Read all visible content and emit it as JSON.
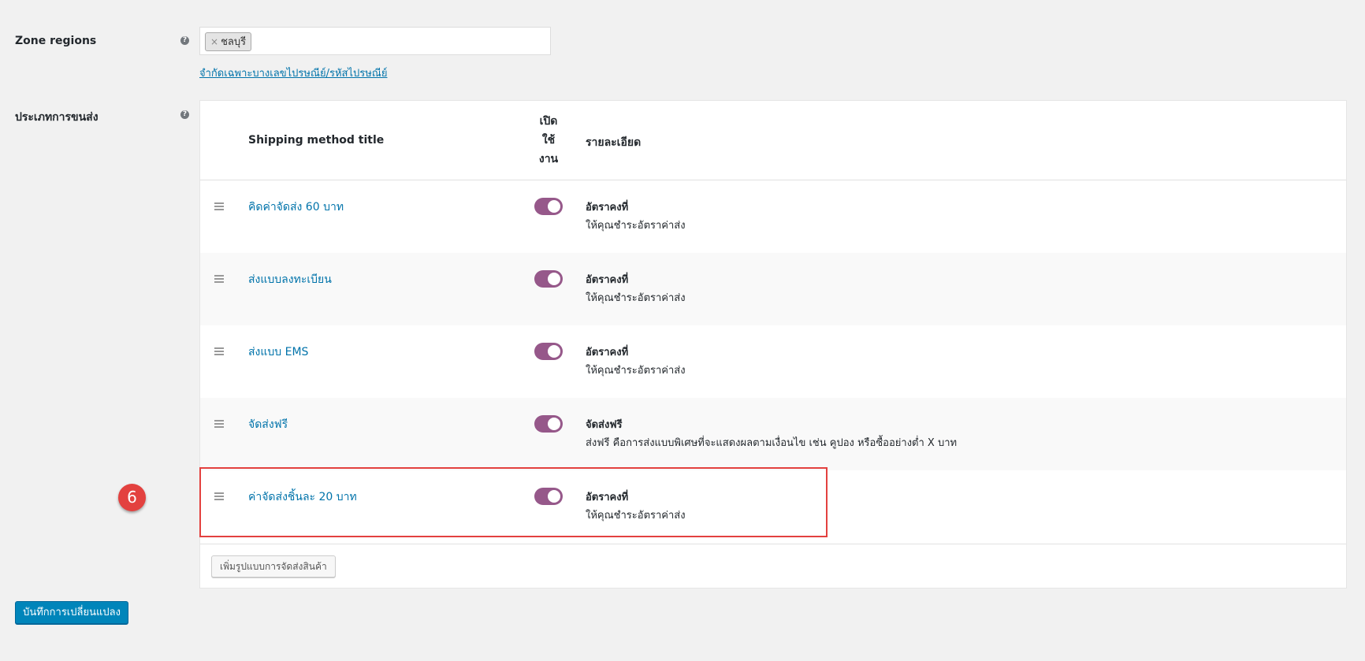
{
  "zone_regions": {
    "label": "Zone regions",
    "help_icon": "?",
    "chips": [
      {
        "remove": "×",
        "label": "ชลบุรี"
      }
    ],
    "postcode_link": "จำกัดเฉพาะบางเลขไปรษณีย์/รหัสไปรษณีย์"
  },
  "shipping_methods": {
    "label": "ประเภทการขนส่ง",
    "help_icon": "?",
    "headers": {
      "title": "Shipping method title",
      "enabled_line1": "เปิด",
      "enabled_line2": "ใช้",
      "enabled_line3": "งาน",
      "description": "รายละเอียด"
    },
    "rows": [
      {
        "title": "คิดค่าจัดส่ง 60 บาท",
        "enabled": true,
        "desc_title": "อัตราคงที่",
        "desc_text": "ให้คุณชำระอัตราค่าส่ง"
      },
      {
        "title": "ส่งแบบลงทะเบียน",
        "enabled": true,
        "desc_title": "อัตราคงที่",
        "desc_text": "ให้คุณชำระอัตราค่าส่ง"
      },
      {
        "title": "ส่งแบบ EMS",
        "enabled": true,
        "desc_title": "อัตราคงที่",
        "desc_text": "ให้คุณชำระอัตราค่าส่ง"
      },
      {
        "title": "จัดส่งฟรี",
        "enabled": true,
        "desc_title": "จัดส่งฟรี",
        "desc_text": "ส่งฟรี คือการส่งแบบพิเศษที่จะแสดงผลตามเงื่อนไข เช่น คูปอง หรือซื้ออย่างต่ำ X บาท"
      },
      {
        "title": "ค่าจัดส่งชิ้นละ 20 บาท",
        "enabled": true,
        "desc_title": "อัตราคงที่",
        "desc_text": "ให้คุณชำระอัตราค่าส่ง"
      }
    ],
    "add_button": "เพิ่มรูปแบบการจัดส่งสินค้า"
  },
  "save_button": "บันทึกการเปลี่ยนแปลง",
  "annotation": {
    "step_number": "6"
  },
  "colors": {
    "link": "#0073aa",
    "toggle_on": "#96588a",
    "primary": "#0085ba",
    "highlight": "#e3413f"
  }
}
